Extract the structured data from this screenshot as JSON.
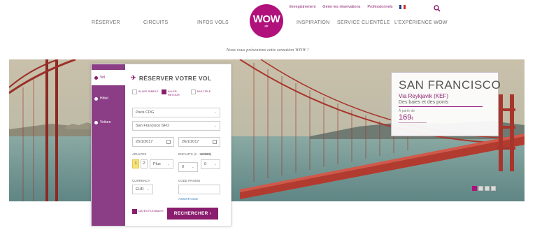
{
  "header": {
    "utility": {
      "checkin": "Enregistrement",
      "manage": "Gérer les réservations",
      "pros": "Professionnels"
    },
    "nav_left": [
      "RÉSERVER",
      "CIRCUITS",
      "INFOS VOLS"
    ],
    "nav_right": [
      "INSPIRATION",
      "SERVICE CLIENTÈLE",
      "L'EXPÉRIENCE WOW"
    ],
    "logo": {
      "text": "WOW",
      "sub": "air"
    }
  },
  "tagline": "Nous vous présentons cette sensation WOW !",
  "booking": {
    "title": "RÉSERVER VOTRE VOL",
    "tabs": [
      "Vol",
      "Hôtel",
      "Voiture"
    ],
    "trip_types": [
      "ALLER SIMPLE",
      "ALLER-RETOUR",
      "MULTIPLE"
    ],
    "from": "Paris CDG",
    "to": "San Francisco SFO",
    "depart_date": "25/1/2017",
    "return_date": "26/1/2017",
    "adults_label": "ADULTES",
    "children_label": "ENFANTS (2 - 16 ANS)",
    "babies_label": "BÉBÉS",
    "adults_options": [
      "1",
      "2"
    ],
    "adults_more": "Plus",
    "children_value": "0",
    "babies_value": "0",
    "currency_label": "CURRENCY",
    "currency_value": "EUR",
    "promo_label": "CODE PROMO",
    "promo_placeholder": "",
    "assistance": "ASSISTANCE",
    "flexible": "DATES FLEXIBLES",
    "search_button": "RECHERCHER ›"
  },
  "promo": {
    "city": "SAN FRANCISCO",
    "via": "Via Reykjavik (KEF)",
    "desc": "Des baies et des ponts",
    "from": "À partir de",
    "price": "169",
    "currency": "€"
  },
  "colors": {
    "brand": "#b0117b",
    "accent": "#8a1d6e",
    "side": "#8b3d86"
  }
}
